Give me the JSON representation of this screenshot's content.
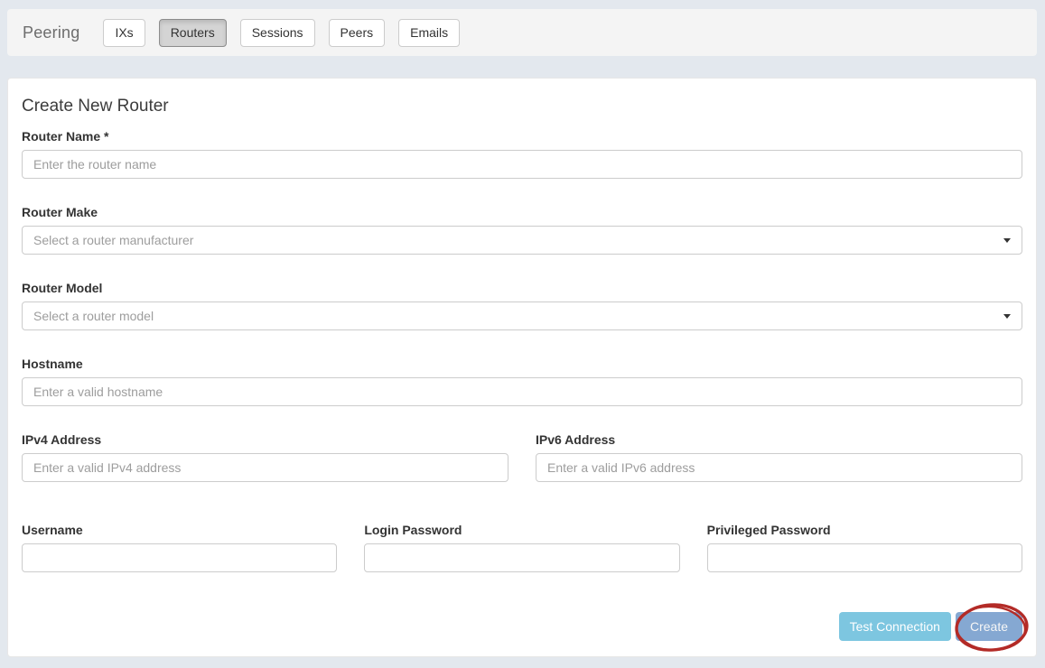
{
  "header": {
    "title": "Peering",
    "tabs": [
      {
        "label": "IXs",
        "active": false
      },
      {
        "label": "Routers",
        "active": true
      },
      {
        "label": "Sessions",
        "active": false
      },
      {
        "label": "Peers",
        "active": false
      },
      {
        "label": "Emails",
        "active": false
      }
    ]
  },
  "form": {
    "title": "Create New Router",
    "fields": {
      "router_name": {
        "label": "Router Name",
        "required_marker": "*",
        "placeholder": "Enter the router name",
        "value": ""
      },
      "router_make": {
        "label": "Router Make",
        "placeholder": "Select a router manufacturer"
      },
      "router_model": {
        "label": "Router Model",
        "placeholder": "Select a router model"
      },
      "hostname": {
        "label": "Hostname",
        "placeholder": "Enter a valid hostname",
        "value": ""
      },
      "ipv4": {
        "label": "IPv4 Address",
        "placeholder": "Enter a valid IPv4 address",
        "value": ""
      },
      "ipv6": {
        "label": "IPv6 Address",
        "placeholder": "Enter a valid IPv6 address",
        "value": ""
      },
      "username": {
        "label": "Username",
        "value": ""
      },
      "login_password": {
        "label": "Login Password",
        "value": ""
      },
      "privileged_password": {
        "label": "Privileged Password",
        "value": ""
      }
    },
    "buttons": {
      "test_connection": "Test Connection",
      "create": "Create"
    }
  },
  "annotation": {
    "shape": "hand-drawn ellipse",
    "target": "create-button",
    "color": "#b32b27"
  },
  "colors": {
    "page_bg": "#e3e8ee",
    "header_bg": "#f4f4f4",
    "panel_bg": "#ffffff",
    "active_tab_bg": "#d4d4d4",
    "test_connection_bg": "#7dc6e0",
    "create_bg": "#85a8d2",
    "label_text": "#333333",
    "placeholder_text": "#9d9d9d"
  }
}
